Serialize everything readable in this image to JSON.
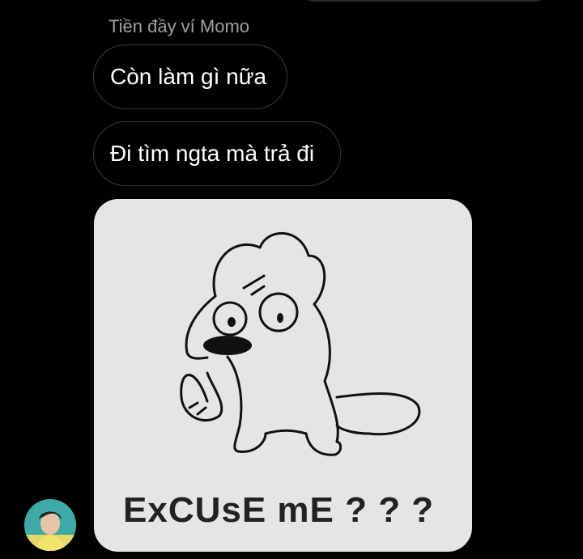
{
  "conversation": {
    "sender_name": "Tiền đầy ví Momo",
    "messages": [
      {
        "type": "text",
        "text": "Còn làm gì nữa"
      },
      {
        "type": "text",
        "text": "Đi tìm ngta mà trả đi"
      },
      {
        "type": "sticker",
        "caption": "ExCUsE mE ? ? ?"
      }
    ]
  },
  "avatar": {
    "icon": "profile-photo-avatar"
  },
  "colors": {
    "background": "#000000",
    "bubble_border": "#3a3a3a",
    "sticker_background": "#e5e5e5",
    "sender_name": "#a0a0a0"
  }
}
